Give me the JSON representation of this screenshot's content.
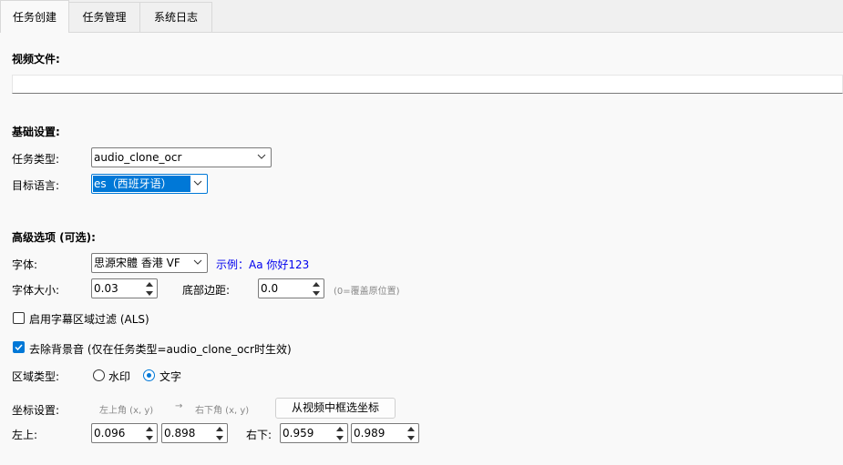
{
  "tabs": [
    "任务创建",
    "任务管理",
    "系统日志"
  ],
  "video_file": {
    "label": "视频文件:",
    "value": ""
  },
  "basic": {
    "title": "基础设置:",
    "task_type_label": "任务类型:",
    "task_type_value": "audio_clone_ocr",
    "target_lang_label": "目标语言:",
    "target_lang_value": "es（西班牙语）"
  },
  "advanced": {
    "title": "高级选项 (可选):",
    "font_label": "字体:",
    "font_value": "思源宋體 香港 VF",
    "font_preview": "示例：Aa 你好123",
    "font_size_label": "字体大小:",
    "font_size_value": "0.03",
    "bottom_margin_label": "底部边距:",
    "bottom_margin_value": "0.0",
    "bottom_margin_hint": "(0=覆盖原位置)",
    "als_label": "启用字幕区域过滤 (ALS)",
    "als_checked": false,
    "remove_bg_label": "去除背景音 (仅在任务类型=audio_clone_ocr时生效)",
    "remove_bg_checked": true,
    "region_type_label": "区域类型:",
    "region_options": [
      "水印",
      "文字"
    ],
    "region_selected": "文字",
    "coord_label": "坐标设置:",
    "coord_hint_top_left": "左上角 (x, y)",
    "coord_arrow": "→",
    "coord_hint_bottom_right": "右下角 (x, y)",
    "select_button": "从视频中框选坐标",
    "top_left_label": "左上:",
    "top_left_x": "0.096",
    "top_left_y": "0.898",
    "bottom_right_label": "右下:",
    "bottom_right_x": "0.959",
    "bottom_right_y": "0.989"
  },
  "colors": {
    "accent": "#0078d7",
    "link": "#0000ee",
    "hint": "#888888"
  }
}
